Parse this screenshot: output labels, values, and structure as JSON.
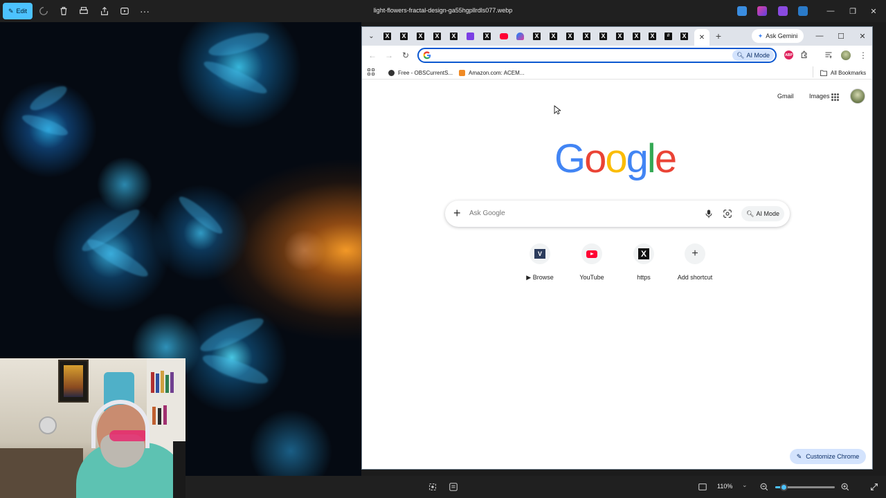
{
  "viewer": {
    "edit_label": "Edit",
    "file_title": "light-flowers-fractal-design-ga55hgpllrdls077.webp",
    "zoom_level": "110%",
    "zoom_fraction": 0.14
  },
  "chrome": {
    "ask_gemini": "Ask Gemini",
    "omnibox_ai_mode": "AI Mode",
    "omnibox_value": "",
    "bookmarks": [
      {
        "label": "Free - OBSCurrentS..."
      },
      {
        "label": "Amazon.com: ACEM..."
      }
    ],
    "all_bookmarks": "All Bookmarks",
    "ntp": {
      "gmail": "Gmail",
      "images": "Images",
      "search_placeholder": "Ask Google",
      "ai_mode": "AI Mode",
      "shortcuts": [
        {
          "label": "Browse",
          "icon": "vox-logo"
        },
        {
          "label": "YouTube",
          "icon": "youtube-icon"
        },
        {
          "label": "https",
          "icon": "x-logo"
        },
        {
          "label": "Add shortcut",
          "icon": "plus-icon"
        }
      ],
      "customize": "Customize Chrome"
    }
  },
  "colors": {
    "accent_blue": "#4cc2ff",
    "chrome_omnibox_border": "#0b57d0",
    "ai_mode_chip": "#d3e3fd",
    "google_blue": "#4285f4",
    "google_red": "#ea4335",
    "google_yellow": "#fbbc05",
    "google_green": "#34a853"
  }
}
